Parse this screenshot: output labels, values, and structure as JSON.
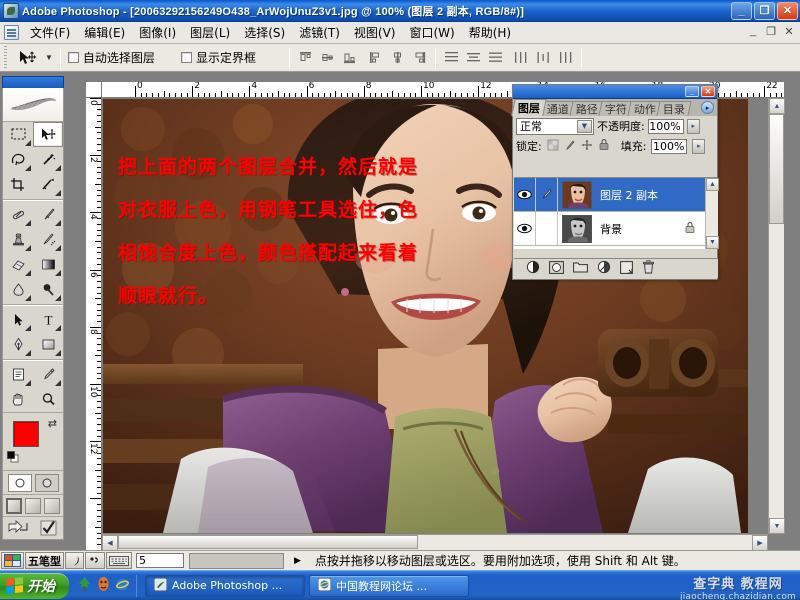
{
  "window": {
    "app_name": "Adobe Photoshop",
    "title": "Adobe Photoshop - [20063292156249O438_ArWojUnuZ3v1.jpg @ 100% (图层 2 副本, RGB/8#)]",
    "minimize": "_",
    "restore": "❐",
    "close": "✕"
  },
  "menu": {
    "items": [
      {
        "label": "文件(F)"
      },
      {
        "label": "编辑(E)"
      },
      {
        "label": "图像(I)"
      },
      {
        "label": "图层(L)"
      },
      {
        "label": "选择(S)"
      },
      {
        "label": "滤镜(T)"
      },
      {
        "label": "视图(V)"
      },
      {
        "label": "窗口(W)"
      },
      {
        "label": "帮助(H)"
      }
    ],
    "mdi_minimize": "_",
    "mdi_restore": "❐",
    "mdi_close": "✕"
  },
  "options_bar": {
    "tool": "move-tool",
    "auto_select_label": "自动选择图层",
    "auto_select_checked": false,
    "show_bounds_label": "显示定界框",
    "show_bounds_checked": false,
    "align_buttons": [
      "align-top-edges",
      "align-vertical-centers",
      "align-bottom-edges",
      "align-left-edges",
      "align-horizontal-centers",
      "align-right-edges",
      "distribute-top-edges",
      "distribute-vertical-centers",
      "distribute-bottom-edges",
      "distribute-left-edges",
      "distribute-horizontal-centers",
      "distribute-right-edges"
    ]
  },
  "toolbox": {
    "tools": [
      "marquee-tool",
      "move-tool",
      "lasso-tool",
      "magic-wand-tool",
      "crop-tool",
      "slice-tool",
      "healing-brush-tool",
      "brush-tool",
      "clone-stamp-tool",
      "history-brush-tool",
      "eraser-tool",
      "gradient-tool",
      "blur-tool",
      "dodge-tool",
      "path-selection-tool",
      "type-tool",
      "pen-tool",
      "shape-tool",
      "notes-tool",
      "eyedropper-tool",
      "hand-tool",
      "zoom-tool"
    ],
    "selected_tool": "move-tool",
    "foreground_color": "#fe0000",
    "background_color": "#ffffff",
    "quickmask_modes": [
      "standard-mode",
      "quick-mask-mode"
    ],
    "screen_modes": [
      "standard-screen-mode",
      "full-screen-with-menubar",
      "full-screen-mode"
    ],
    "jump_to_imageready": "jump-to-imageready-icon"
  },
  "document": {
    "zoom": "100%",
    "ruler_unit": "cm",
    "h_ruler_labels": [
      "0",
      "2",
      "4",
      "6",
      "8",
      "10",
      "12",
      "14",
      "16",
      "18",
      "20",
      "22"
    ],
    "v_ruler_labels": [
      "0",
      "2",
      "4",
      "6",
      "8",
      "10",
      "12"
    ]
  },
  "layers_panel": {
    "tabs": [
      {
        "label": "图层",
        "active": true
      },
      {
        "label": "通道",
        "active": false
      },
      {
        "label": "路径",
        "active": false
      },
      {
        "label": "字符",
        "active": false
      },
      {
        "label": "动作",
        "active": false
      },
      {
        "label": "目录",
        "active": false
      }
    ],
    "blend_mode": "正常",
    "opacity_label": "不透明度:",
    "opacity_value": "100%",
    "fill_label": "填充:",
    "fill_value": "100%",
    "lock_label": "锁定:",
    "lock_icons": [
      "lock-transparent-pixels-icon",
      "lock-image-pixels-icon",
      "lock-position-icon",
      "lock-all-icon"
    ],
    "layers": [
      {
        "name": "图层 2 副本",
        "visible": true,
        "selected": true,
        "locked": false,
        "has_brush_icon": true
      },
      {
        "name": "背景",
        "visible": true,
        "selected": false,
        "locked": true,
        "has_brush_icon": false
      }
    ],
    "bottom_buttons": [
      "layer-style-icon",
      "layer-mask-icon",
      "new-group-icon",
      "adjustment-layer-icon",
      "new-layer-icon",
      "delete-layer-icon"
    ],
    "minimize": "_",
    "close": "✕",
    "panel_menu": "▸"
  },
  "overlay_text": {
    "lines": [
      "把上面的两个图层合并，然后就是",
      "对衣服上色，用钢笔工具选住，色",
      "相饱合度上色，颜色搭配起来看着",
      "顺眼就行。"
    ],
    "color": "#ff0000"
  },
  "status_bar": {
    "ime_lang": "五笔型",
    "ime_buttons": [
      "ime-logo-icon",
      "ime-halfwidth-icon",
      "ime-punctuation-icon",
      "ime-softkeyboard-icon"
    ],
    "zoom_value": "5",
    "hint": "点按并拖移以移动图层或选区。要用附加选项，使用 Shift 和 Alt 键。",
    "expand_arrow": "▶"
  },
  "taskbar": {
    "start_label": "开始",
    "quick_launch": [
      "launch-green-icon",
      "launch-orange-icon",
      "launch-ie-icon"
    ],
    "tasks": [
      {
        "label": "Adobe Photoshop ...",
        "icon": "photoshop-icon",
        "active": true
      },
      {
        "label": "中国教程网论坛 ...",
        "icon": "ie-icon",
        "active": false
      }
    ],
    "watermark_top": "查字典 教程网",
    "watermark_bottom": "jiaocheng.chazidian.com"
  }
}
